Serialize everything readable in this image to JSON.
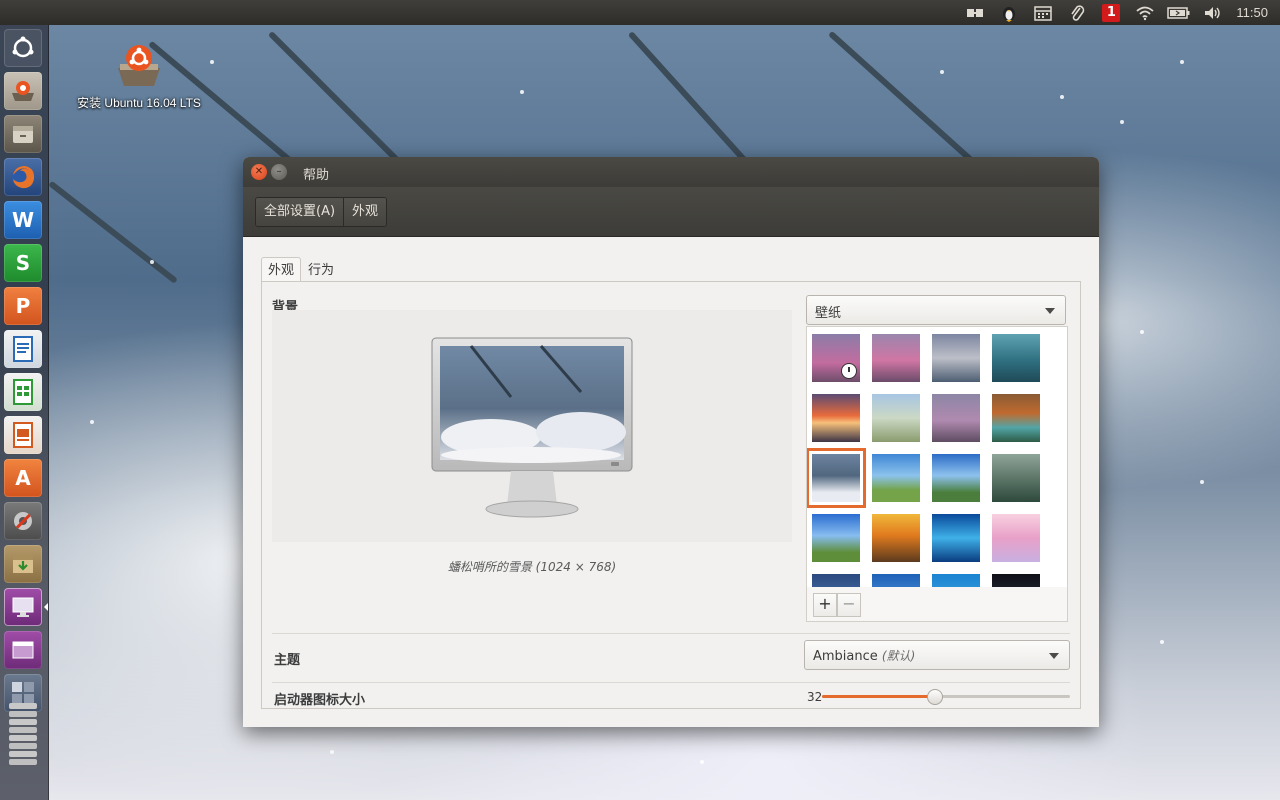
{
  "top_panel": {
    "indicators": [
      "transfer-icon",
      "tux-icon",
      "calendar-icon",
      "paperclip-icon",
      "notification-badge",
      "wifi-icon",
      "battery-icon",
      "volume-icon"
    ],
    "badge_count": "1",
    "clock": "11:50"
  },
  "desktop": {
    "install_icon_label": "安装 Ubuntu 16.04 LTS"
  },
  "launcher": {
    "items": [
      "ubuntu-dash",
      "ubuntu-installer",
      "files",
      "firefox",
      "wps-writer",
      "wps-spreadsheets",
      "wps-presentation",
      "libreoffice-writer",
      "libreoffice-calc",
      "libreoffice-impress",
      "ubuntu-software",
      "system-settings",
      "archive-manager",
      "appearance-settings",
      "workspace-switcher",
      "show-desktop",
      "trash"
    ]
  },
  "window": {
    "title": "帮助",
    "breadcrumb": [
      "全部设置(A)",
      "外观"
    ],
    "tabs": [
      "外观",
      "行为"
    ],
    "background_label": "背景",
    "wallpaper_combo": "壁纸",
    "preview_caption": "蟠松哨所的雪景 (1024 × 768)",
    "add_button": "+",
    "remove_button": "−",
    "theme_label": "主题",
    "theme_value": "Ambiance",
    "theme_default": "(默认)",
    "icon_size_label": "启动器图标大小",
    "icon_size_value": "32",
    "icon_size_fraction": 0.45
  },
  "colors": {
    "accent": "#e46a2e",
    "panel": "#3f3e3a",
    "window_bg": "#f2f1f0"
  }
}
